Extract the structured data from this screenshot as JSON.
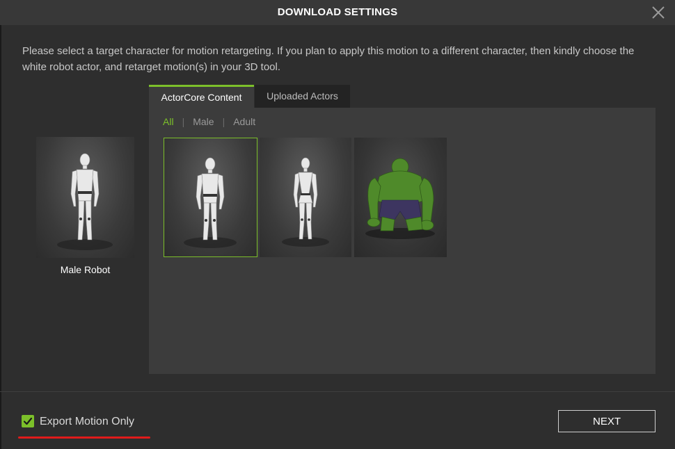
{
  "dialog": {
    "title": "DOWNLOAD SETTINGS",
    "close_icon": "close-icon"
  },
  "description": "Please select a target character for motion retargeting. If you plan to apply this motion to a different character, then kindly choose the white robot actor, and retarget motion(s) in your 3D tool.",
  "preview": {
    "name": "Male Robot"
  },
  "tabs": [
    {
      "label": "ActorCore Content",
      "active": true
    },
    {
      "label": "Uploaded Actors",
      "active": false
    }
  ],
  "filters": [
    {
      "label": "All",
      "active": true
    },
    {
      "label": "Male",
      "active": false
    },
    {
      "label": "Adult",
      "active": false
    }
  ],
  "characters": [
    {
      "id": "male-robot",
      "selected": true
    },
    {
      "id": "female-robot",
      "selected": false
    },
    {
      "id": "green-monster",
      "selected": false
    }
  ],
  "footer": {
    "export_motion_only_label": "Export Motion Only",
    "export_motion_only_checked": true,
    "next_label": "NEXT"
  },
  "colors": {
    "accent": "#7cc02a",
    "highlight_underline": "#e01b1b"
  }
}
